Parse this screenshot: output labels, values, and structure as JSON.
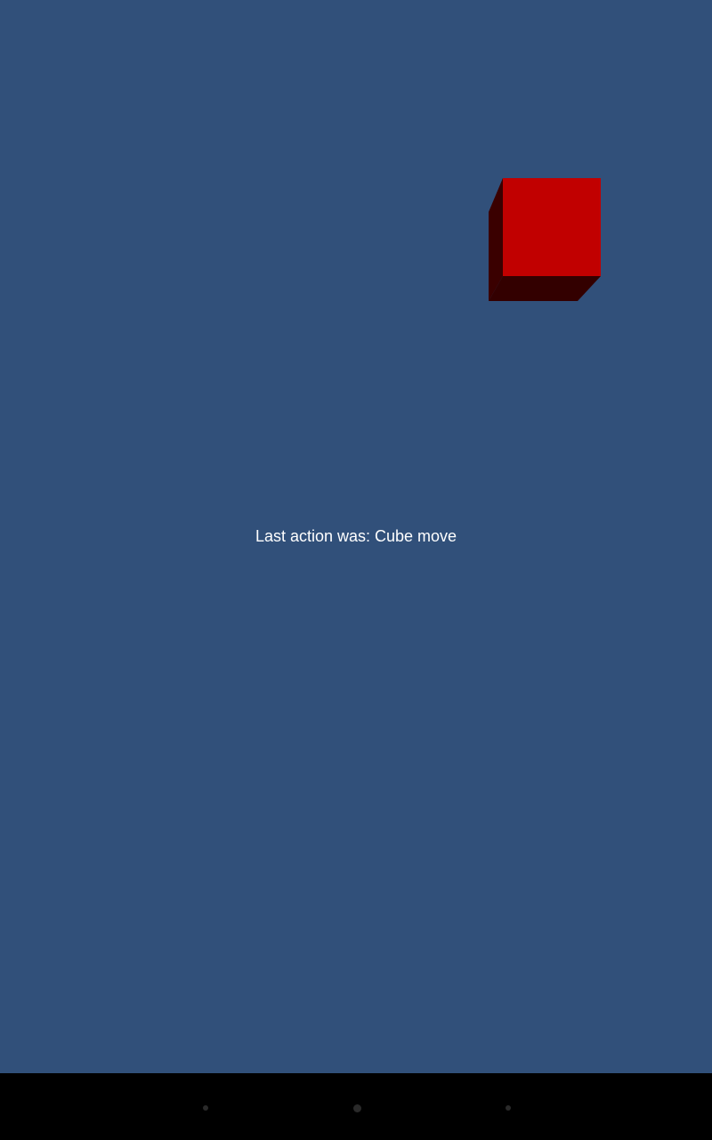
{
  "scene": {
    "background_color": "#31507a",
    "cube": {
      "front_color": "#c10000",
      "side_color": "#3a0000",
      "bottom_color": "#330000"
    },
    "status": {
      "text": "Last action was: Cube move"
    }
  },
  "navigation_bar": {
    "buttons": [
      {
        "icon": "back-icon"
      },
      {
        "icon": "home-icon"
      },
      {
        "icon": "recents-icon"
      }
    ]
  }
}
